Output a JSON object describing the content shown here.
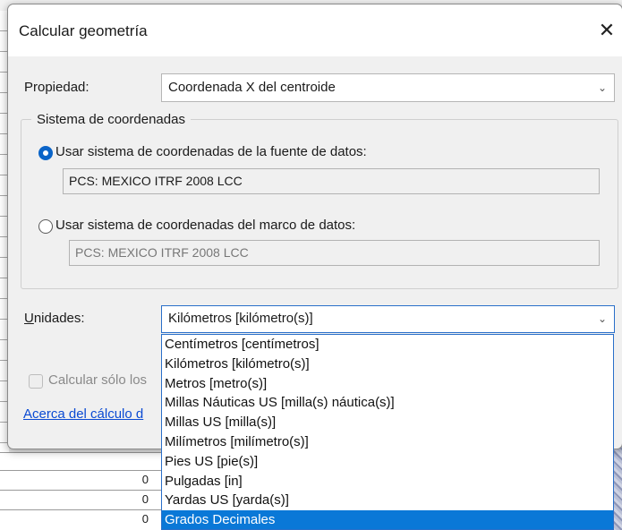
{
  "dialog": {
    "title": "Calcular geometría",
    "close_glyph": "✕"
  },
  "property": {
    "label": "Propiedad:",
    "value": "Coordenada X del centroide"
  },
  "coord_system": {
    "group_label": "Sistema de coordenadas",
    "option_source": {
      "label": "Usar sistema de coordenadas de la fuente de datos:",
      "selected": true,
      "value": "PCS: MEXICO ITRF 2008 LCC"
    },
    "option_frame": {
      "label": "Usar sistema de coordenadas del marco de datos:",
      "selected": false,
      "value": "PCS: MEXICO ITRF 2008 LCC"
    }
  },
  "units": {
    "label_mnemonic": "U",
    "label_rest": "nidades:",
    "value": "Kilómetros [kilómetro(s)]",
    "options": [
      "Centímetros [centímetros]",
      "Kilómetros [kilómetro(s)]",
      "Metros [metro(s)]",
      "Millas Náuticas US [milla(s) náutica(s)]",
      "Millas US [milla(s)]",
      "Milímetros [milímetro(s)]",
      "Pies US [pie(s)]",
      "Pulgadas [in]",
      "Yardas US [yarda(s)]",
      "Grados Decimales"
    ],
    "highlighted": "Grados Decimales"
  },
  "selected_only": {
    "label": "Calcular sólo los",
    "checked": false
  },
  "about_link": "Acerca del cálculo d",
  "background_table": {
    "values": [
      "0",
      "0",
      "0"
    ]
  },
  "colors": {
    "accent": "#0a78d7",
    "link": "#0a4ad3"
  }
}
